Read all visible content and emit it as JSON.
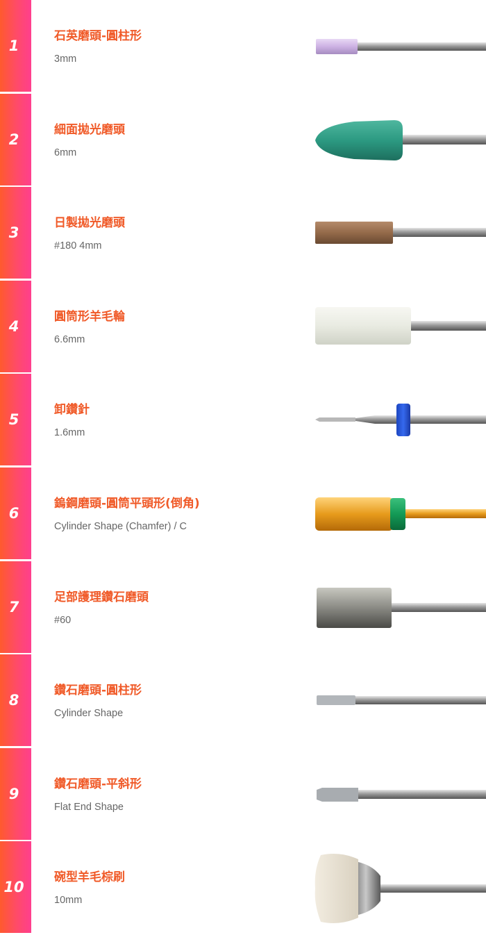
{
  "items": [
    {
      "number": "1",
      "title": "石英磨頭-圓柱形",
      "spec": "3mm",
      "icon": "quartz-cylinder-bit-icon"
    },
    {
      "number": "2",
      "title": "細面拋光磨頭",
      "spec": "6mm",
      "icon": "fine-polishing-cone-bit-icon"
    },
    {
      "number": "3",
      "title": "日製拋光磨頭",
      "spec": "#180 4mm",
      "icon": "japanese-polishing-bit-icon"
    },
    {
      "number": "4",
      "title": "圓筒形羊毛輪",
      "spec": "6.6mm",
      "icon": "wool-cylinder-wheel-icon"
    },
    {
      "number": "5",
      "title": "卸鑽針",
      "spec": "1.6mm",
      "icon": "removal-drill-bit-icon"
    },
    {
      "number": "6",
      "title": "鎢鋼磨頭-圓筒平頭形(倒角)",
      "spec": "Cylinder Shape (Chamfer) / C",
      "icon": "carbide-cylinder-bit-icon"
    },
    {
      "number": "7",
      "title": "足部護理鑽石磨頭",
      "spec": "#60",
      "icon": "foot-care-diamond-bit-icon"
    },
    {
      "number": "8",
      "title": "鑽石磨頭-圓柱形",
      "spec": "Cylinder Shape",
      "icon": "diamond-cylinder-bit-icon"
    },
    {
      "number": "9",
      "title": "鑽石磨頭-平斜形",
      "spec": "Flat End Shape",
      "icon": "diamond-flat-end-bit-icon"
    },
    {
      "number": "10",
      "title": "碗型羊毛棕刷",
      "spec": "10mm",
      "icon": "bowl-wool-brush-icon"
    }
  ],
  "colors": {
    "accent_gradient_start": "#ff5a2e",
    "accent_gradient_end": "#ff3f8e",
    "title": "#f05a28",
    "spec": "#666666"
  }
}
